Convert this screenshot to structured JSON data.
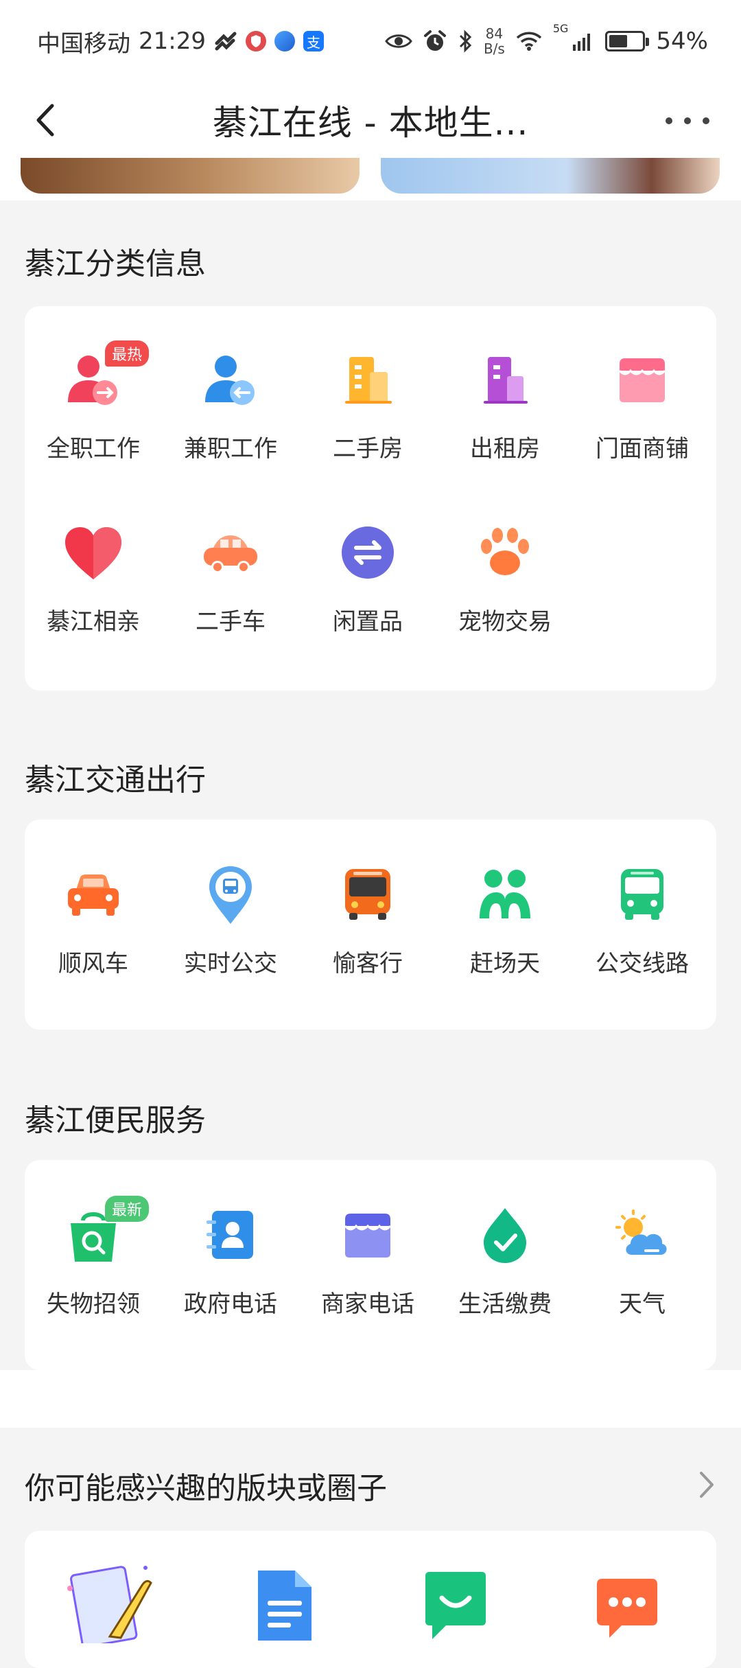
{
  "status": {
    "carrier": "中国移动",
    "time": "21:29",
    "netspeed_value": "84",
    "netspeed_unit": "B/s",
    "network": "5G",
    "battery": "54%",
    "alipay_glyph": "支"
  },
  "nav": {
    "title": "綦江在线 - 本地生..."
  },
  "sections": {
    "classified": {
      "title": "綦江分类信息",
      "items": [
        {
          "label": "全职工作",
          "tag": "最热"
        },
        {
          "label": "兼职工作"
        },
        {
          "label": "二手房"
        },
        {
          "label": "出租房"
        },
        {
          "label": "门面商铺"
        },
        {
          "label": "綦江相亲"
        },
        {
          "label": "二手车"
        },
        {
          "label": "闲置品"
        },
        {
          "label": "宠物交易"
        }
      ]
    },
    "transport": {
      "title": "綦江交通出行",
      "items": [
        {
          "label": "顺风车"
        },
        {
          "label": "实时公交"
        },
        {
          "label": "愉客行"
        },
        {
          "label": "赶场天"
        },
        {
          "label": "公交线路"
        }
      ]
    },
    "services": {
      "title": "綦江便民服务",
      "items": [
        {
          "label": "失物招领",
          "tag": "最新"
        },
        {
          "label": "政府电话"
        },
        {
          "label": "商家电话"
        },
        {
          "label": "生活缴费"
        },
        {
          "label": "天气"
        }
      ]
    },
    "recommend": {
      "title": "你可能感兴趣的版块或圈子"
    }
  }
}
